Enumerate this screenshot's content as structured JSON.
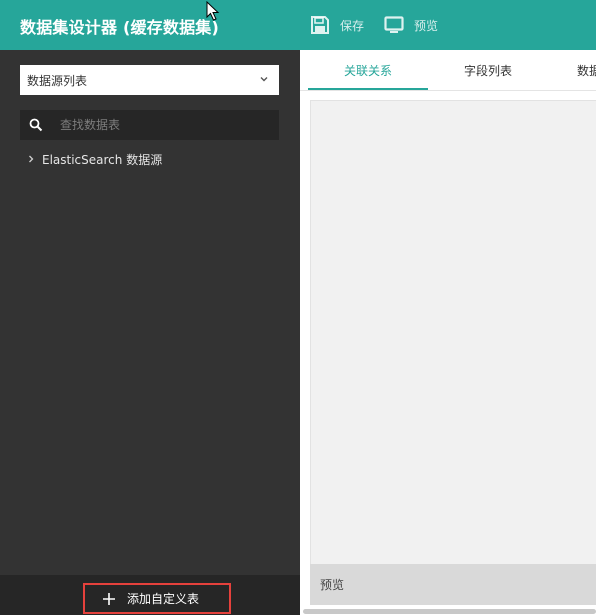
{
  "header": {
    "title": "数据集设计器 (缓存数据集)",
    "save_label": "保存",
    "preview_label": "预览",
    "bg_color": "#26a69a"
  },
  "sidebar": {
    "select_value": "数据源列表",
    "search_placeholder": "查找数据表",
    "tree": [
      {
        "label": "ElasticSearch 数据源",
        "icon": "chevron-right-icon"
      }
    ],
    "add_button_label": "添加自定义表"
  },
  "main": {
    "tabs": [
      {
        "label": "关联关系",
        "active": true
      },
      {
        "label": "字段列表",
        "active": false
      },
      {
        "label": "数据",
        "active": false
      }
    ],
    "preview_bar_label": "预览",
    "accent_color": "#26a69a"
  }
}
